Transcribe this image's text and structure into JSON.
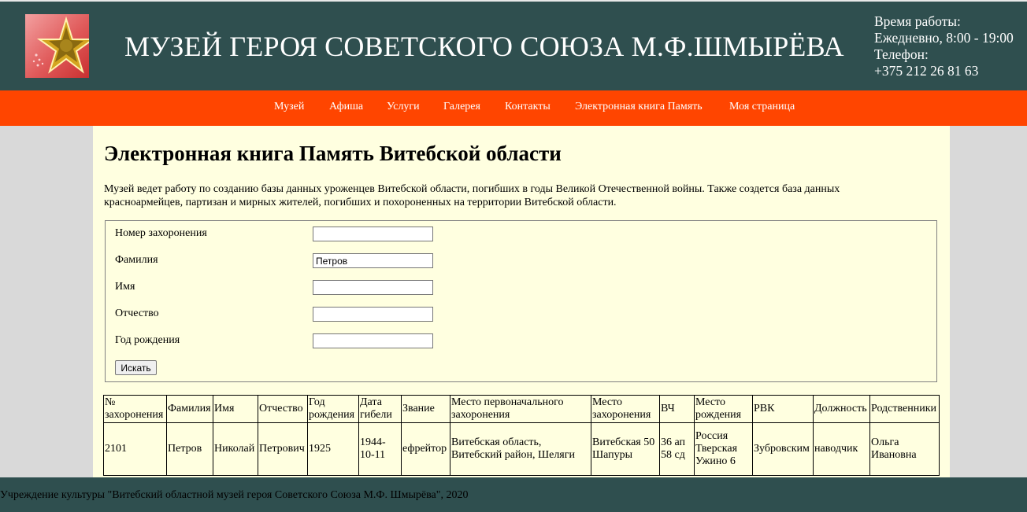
{
  "header": {
    "title": "МУЗЕЙ ГЕРОЯ СОВЕТСКОГО СОЮЗА М.Ф.ШМЫРЁВА",
    "hours_label": "Время работы:",
    "hours_value": "Ежедневно, 8:00 - 19:00",
    "phone_label": "Телефон:",
    "phone_value": "+375 212 26 81 63",
    "logo_icon": "gold-star-icon"
  },
  "nav": {
    "items": [
      {
        "label": "Музей"
      },
      {
        "label": "Афиша"
      },
      {
        "label": "Услуги"
      },
      {
        "label": "Галерея"
      },
      {
        "label": "Контакты"
      },
      {
        "label": "Электронная книга Память"
      },
      {
        "label": "Моя страница"
      }
    ]
  },
  "main": {
    "title": "Электронная книга Память Витебской области",
    "intro": "Музей ведет работу по созданию базы данных уроженцев Витебской области, погибших в годы Великой Отечественной войны. Также создется база данных красноармейцев, партизан и мирных жителей, погибших и похороненных на территории Витебской области."
  },
  "search": {
    "fields": [
      {
        "label": "Номер захоронения",
        "value": ""
      },
      {
        "label": "Фамилия",
        "value": "Петров"
      },
      {
        "label": "Имя",
        "value": ""
      },
      {
        "label": "Отчество",
        "value": ""
      },
      {
        "label": "Год рождения",
        "value": ""
      }
    ],
    "button_label": "Искать"
  },
  "results": {
    "columns": [
      "№ захоронения",
      "Фамилия",
      "Имя",
      "Отчество",
      "Год рождения",
      "Дата гибели",
      "Звание",
      "Место первоначального захоронения",
      "Место захоронения",
      "ВЧ",
      "Место рождения",
      "РВК",
      "Должность",
      "Родственники"
    ],
    "rows": [
      [
        "2101",
        "Петров",
        "Николай",
        "Петрович",
        "1925",
        "1944-10-11",
        "ефрейтор",
        "Витебская область, Витебский район, Шеляги",
        "Витебская 50 Шапуры",
        "36 ап 58 сд",
        "Россия Тверская Ужино 6",
        "Зубровским",
        "наводчик",
        "Ольга Ивановна"
      ]
    ]
  },
  "footer": {
    "text": "Учреждение культуры \"Витебский областной музей героя Советского Союза М.Ф. Шмырёва\", 2020"
  },
  "colors": {
    "header_bg": "#2f4f4f",
    "nav_bg": "#ff4500",
    "content_bg": "#ffffe0",
    "page_bg": "#d9d9d9"
  }
}
